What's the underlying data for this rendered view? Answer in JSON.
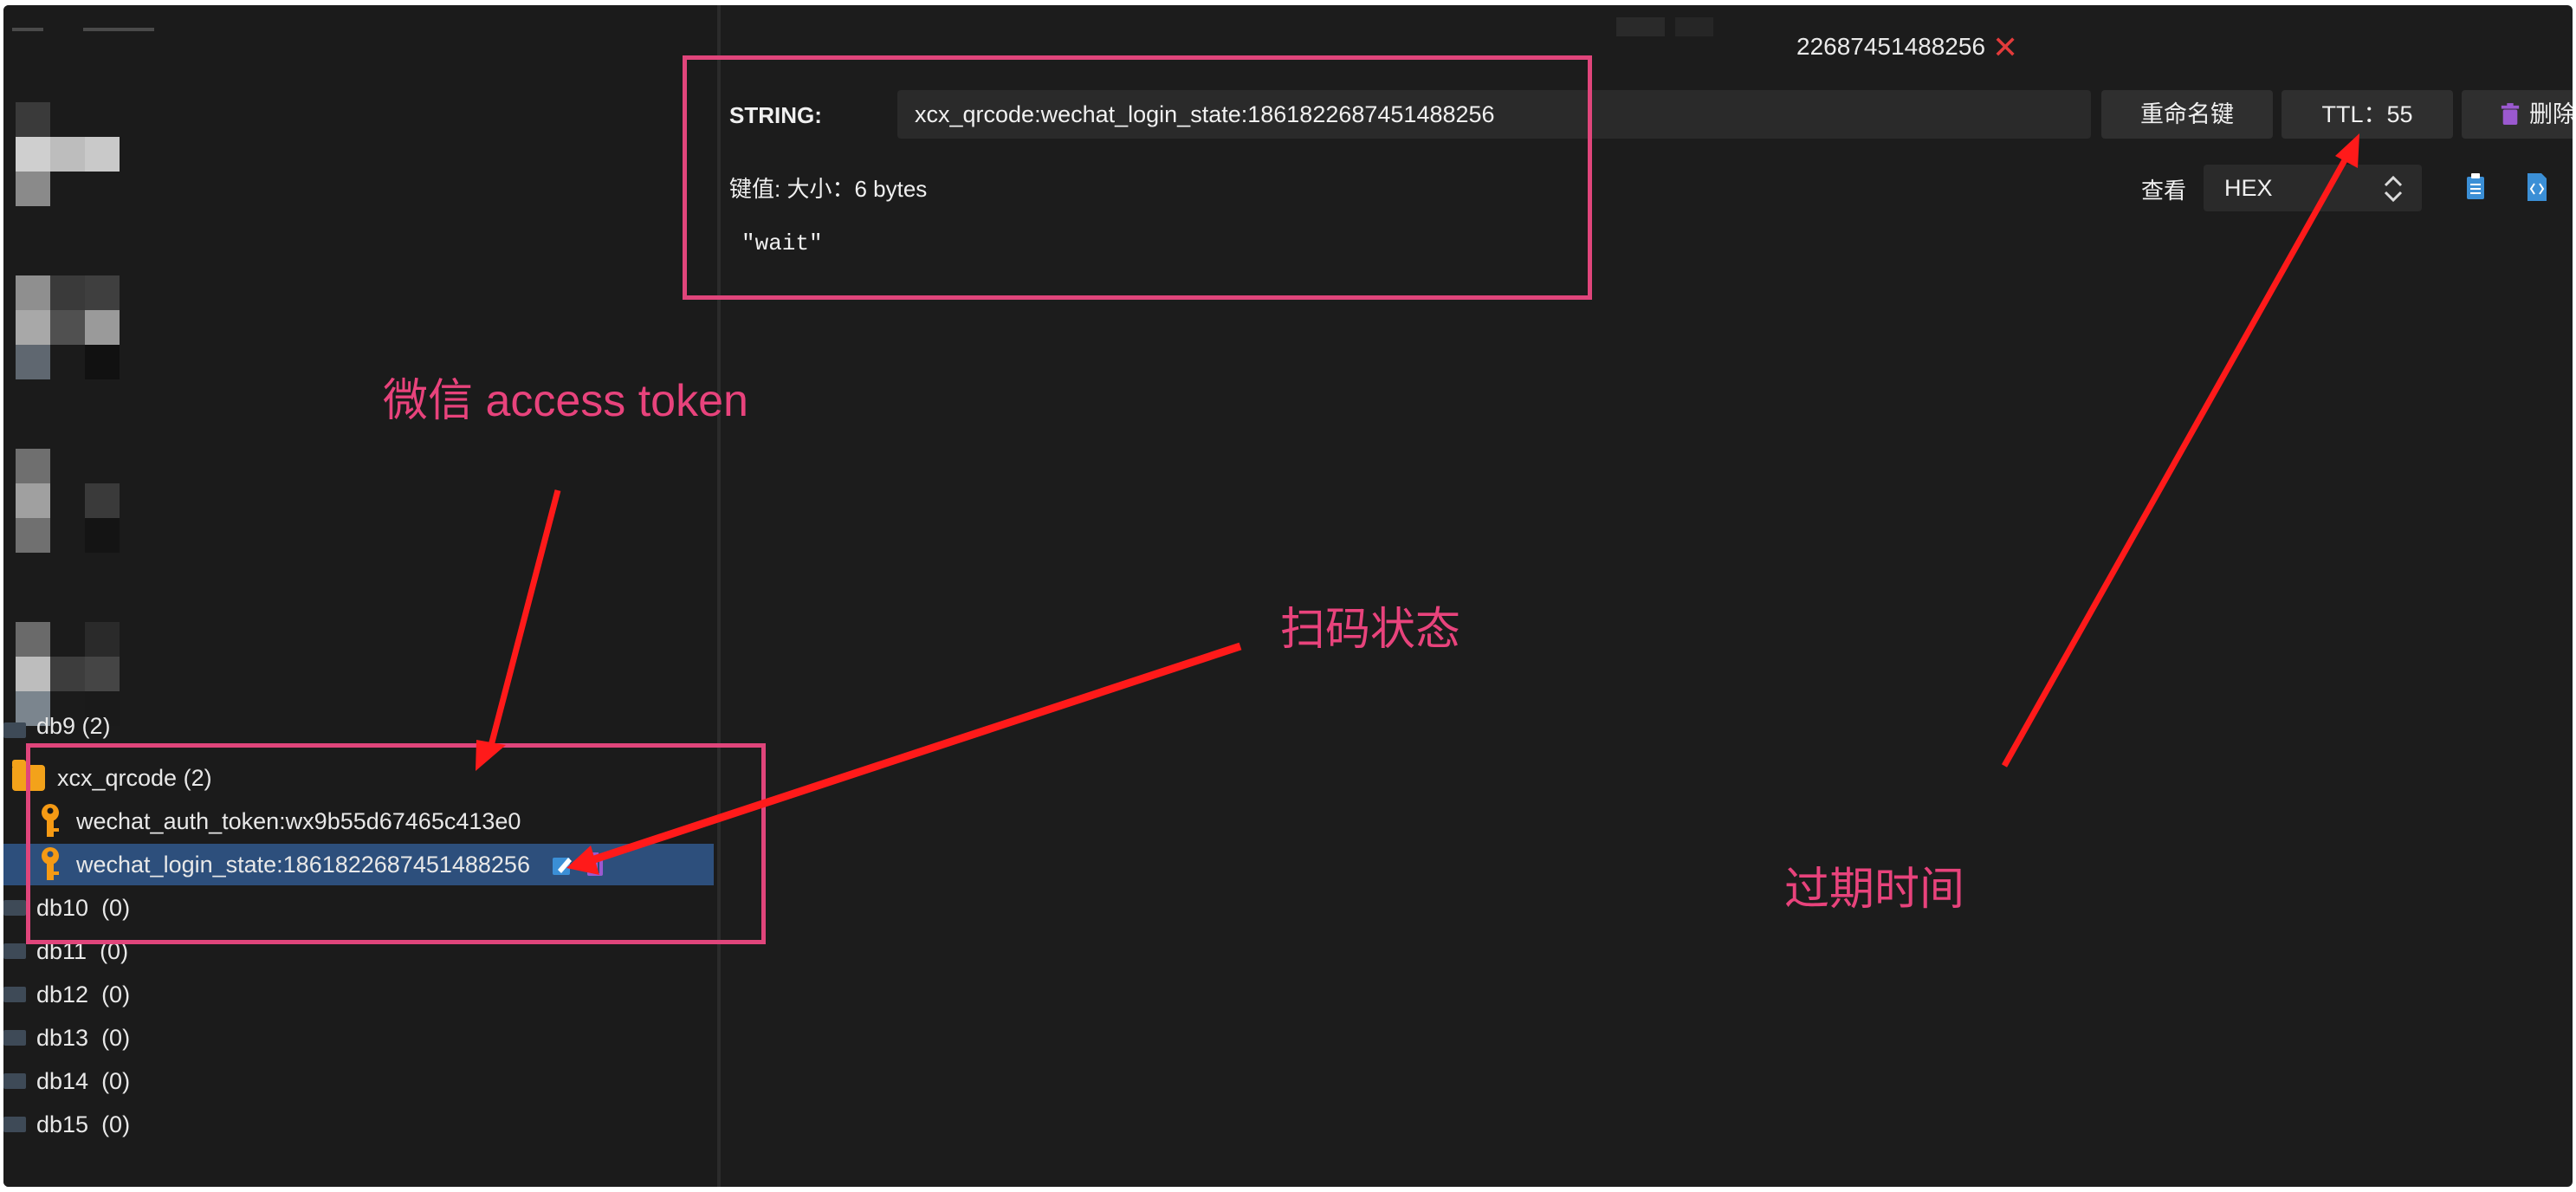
{
  "tab": {
    "title": "22687451488256",
    "close": "✕"
  },
  "key_header": {
    "type_label": "STRING:",
    "key_name": "xcx_qrcode:wechat_login_state:1861822687451488256",
    "rename_button": "重命名键",
    "ttl_button": "TTL：55",
    "delete_button": "删除"
  },
  "value_info": {
    "size_label": "键值: 大小：6 bytes",
    "view_label": "查看",
    "view_mode": "HEX",
    "value": "\"wait\""
  },
  "tree": {
    "partial_db": "db9 (2)",
    "folder": "xcx_qrcode (2)",
    "keys": [
      "wechat_auth_token:wx9b55d67465c413e0",
      "wechat_login_state:1861822687451488256"
    ],
    "dbs": [
      "db10  (0)",
      "db11  (0)",
      "db12  (0)",
      "db13  (0)",
      "db14  (0)",
      "db15  (0)"
    ]
  },
  "annotations": {
    "access_token": "微信 access token",
    "scan_state": "扫码状态",
    "expire_time": "过期时间"
  },
  "colors": {
    "background": "#1c1c1c",
    "selection": "#2d4f7c",
    "annotation": "#e8437c",
    "arrow": "#ff1a1a",
    "folder": "#f3a21a",
    "key_icon": "#f59a14",
    "trash": "#9b59d0",
    "close": "#e33b3b"
  },
  "icons": [
    "folder-icon",
    "key-icon",
    "edit-icon",
    "trash-icon",
    "copy-icon",
    "code-icon",
    "close-icon",
    "database-icon"
  ]
}
